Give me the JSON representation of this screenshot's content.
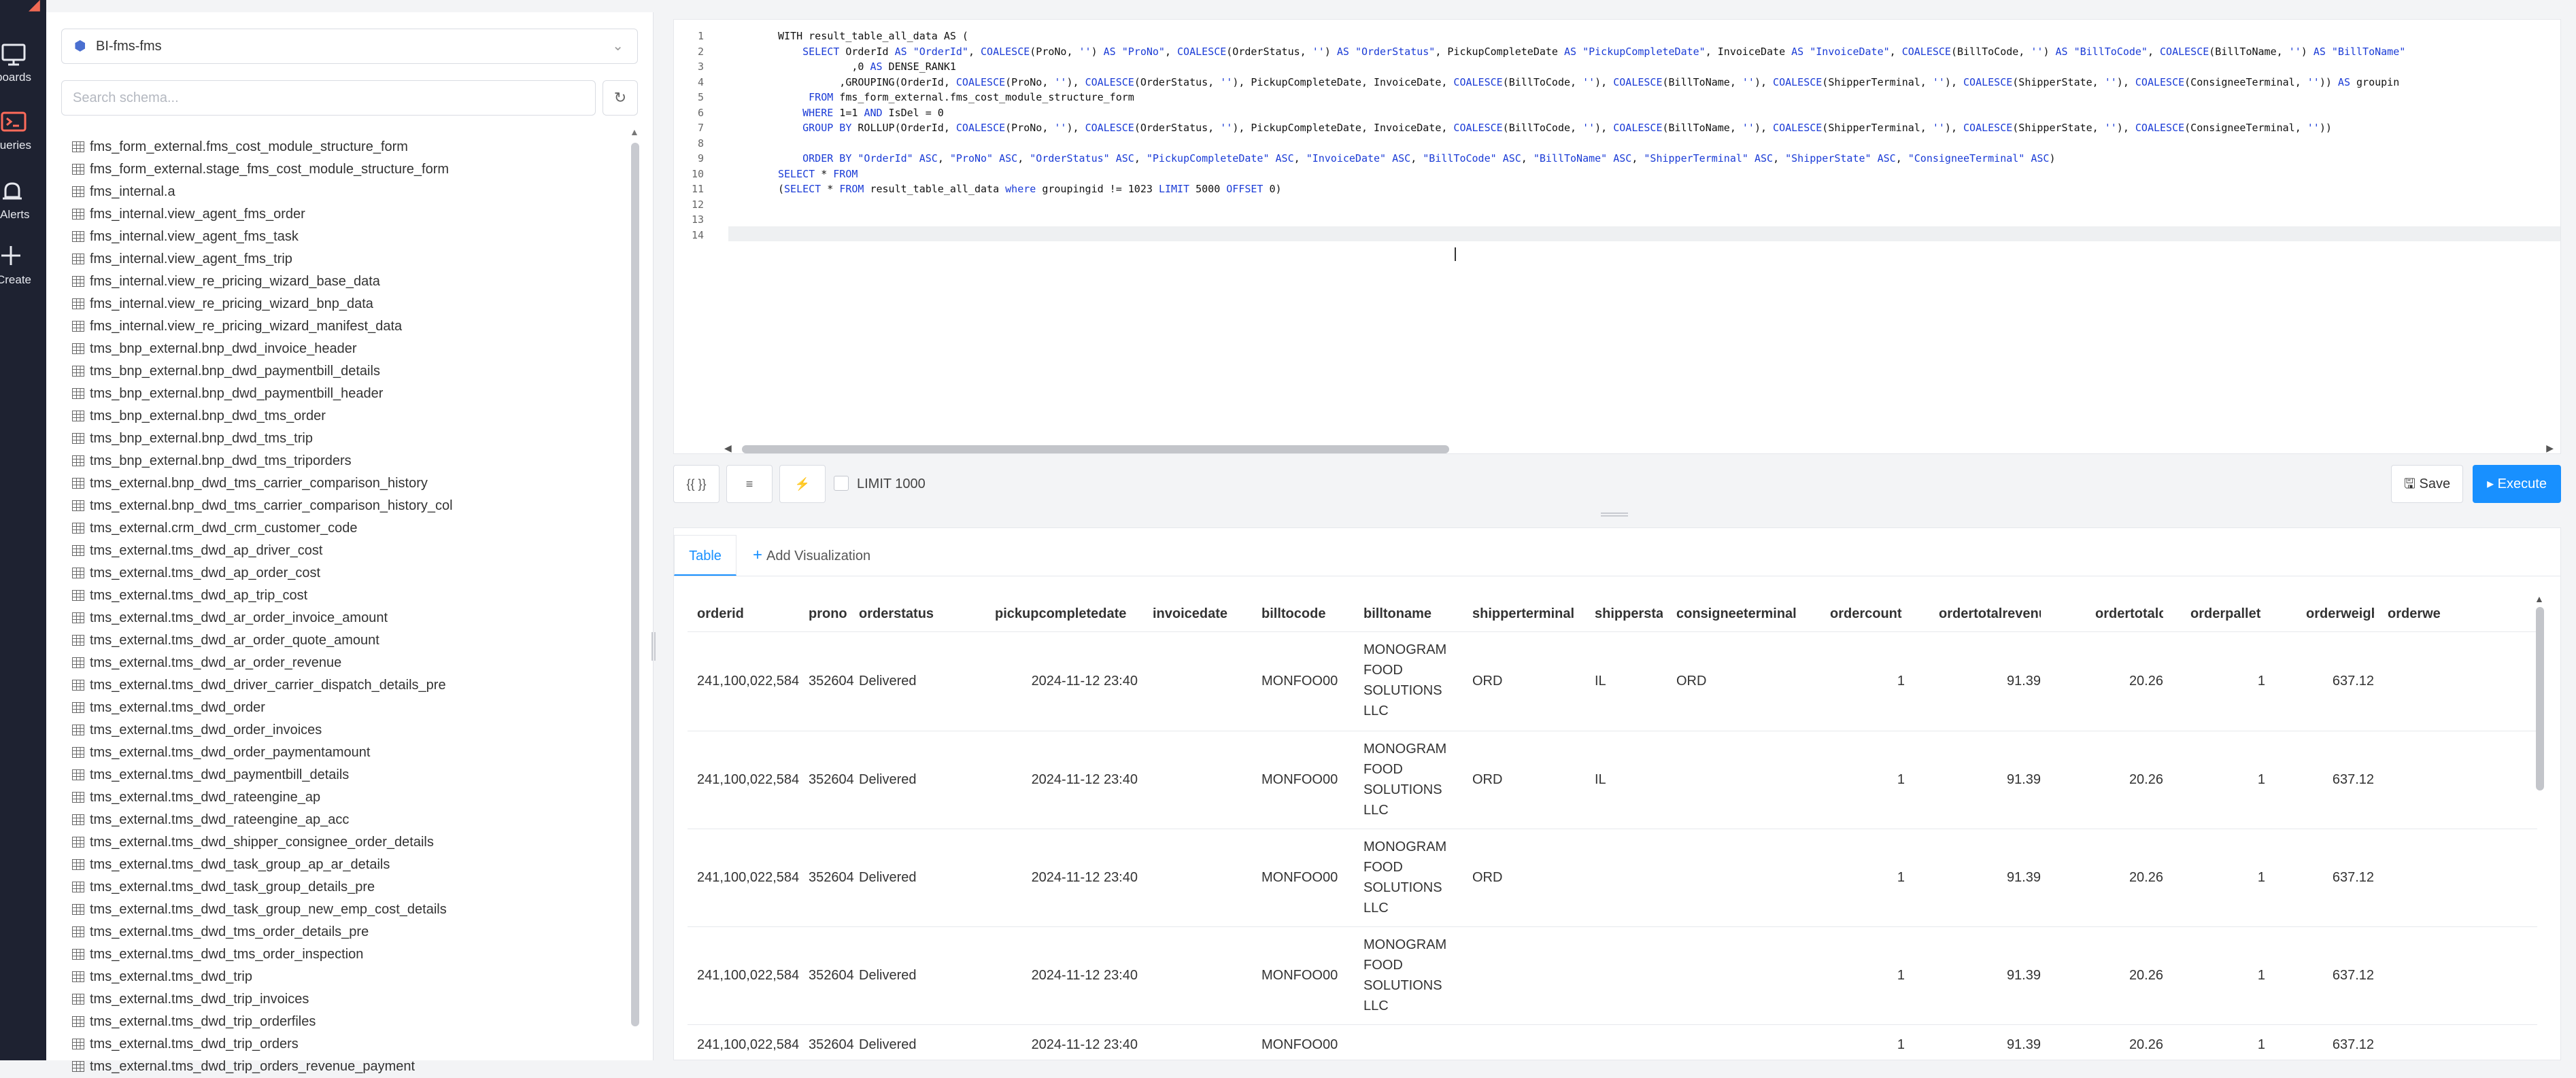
{
  "nav": {
    "items": [
      {
        "label": "Dashboards",
        "icon": "monitor-icon"
      },
      {
        "label": "Queries",
        "icon": "terminal-icon"
      },
      {
        "label": "Alerts",
        "icon": "bell-icon"
      },
      {
        "label": "Create",
        "icon": "plus-icon"
      }
    ]
  },
  "schema": {
    "database": "BI-fms-fms",
    "search_placeholder": "Search schema...",
    "tables": [
      "fms_form_external.fms_cost_module_structure_form",
      "fms_form_external.stage_fms_cost_module_structure_form",
      "fms_internal.a",
      "fms_internal.view_agent_fms_order",
      "fms_internal.view_agent_fms_task",
      "fms_internal.view_agent_fms_trip",
      "fms_internal.view_re_pricing_wizard_base_data",
      "fms_internal.view_re_pricing_wizard_bnp_data",
      "fms_internal.view_re_pricing_wizard_manifest_data",
      "tms_bnp_external.bnp_dwd_invoice_header",
      "tms_bnp_external.bnp_dwd_paymentbill_details",
      "tms_bnp_external.bnp_dwd_paymentbill_header",
      "tms_bnp_external.bnp_dwd_tms_order",
      "tms_bnp_external.bnp_dwd_tms_trip",
      "tms_bnp_external.bnp_dwd_tms_triporders",
      "tms_external.bnp_dwd_tms_carrier_comparison_history",
      "tms_external.bnp_dwd_tms_carrier_comparison_history_col",
      "tms_external.crm_dwd_crm_customer_code",
      "tms_external.tms_dwd_ap_driver_cost",
      "tms_external.tms_dwd_ap_order_cost",
      "tms_external.tms_dwd_ap_trip_cost",
      "tms_external.tms_dwd_ar_order_invoice_amount",
      "tms_external.tms_dwd_ar_order_quote_amount",
      "tms_external.tms_dwd_ar_order_revenue",
      "tms_external.tms_dwd_driver_carrier_dispatch_details_pre",
      "tms_external.tms_dwd_order",
      "tms_external.tms_dwd_order_invoices",
      "tms_external.tms_dwd_order_paymentamount",
      "tms_external.tms_dwd_paymentbill_details",
      "tms_external.tms_dwd_rateengine_ap",
      "tms_external.tms_dwd_rateengine_ap_acc",
      "tms_external.tms_dwd_shipper_consignee_order_details",
      "tms_external.tms_dwd_task_group_ap_ar_details",
      "tms_external.tms_dwd_task_group_details_pre",
      "tms_external.tms_dwd_task_group_new_emp_cost_details",
      "tms_external.tms_dwd_tms_order_details_pre",
      "tms_external.tms_dwd_tms_order_inspection",
      "tms_external.tms_dwd_trip",
      "tms_external.tms_dwd_trip_invoices",
      "tms_external.tms_dwd_trip_orderfiles",
      "tms_external.tms_dwd_trip_orders",
      "tms_external.tms_dwd_trip_orders_revenue_payment"
    ]
  },
  "editor": {
    "line_numbers": [
      "1",
      "2",
      "3",
      "4",
      "5",
      "6",
      "7",
      "8",
      "9",
      "10",
      "11",
      "12",
      "13",
      "14"
    ]
  },
  "toolbar": {
    "format_label": "{{ }}",
    "indent_label": "≡",
    "autocomplete_label": "⚡",
    "limit_label": "LIMIT 1000",
    "save_label": "Save",
    "execute_label": "Execute"
  },
  "results": {
    "tab_table": "Table",
    "tab_add_viz": "Add Visualization",
    "columns": [
      "orderid",
      "prono",
      "orderstatus",
      "pickupcompletedate",
      "invoicedate",
      "billtocode",
      "billtoname",
      "shipperterminal",
      "shipperstate",
      "consigneeterminal",
      "ordercount",
      "ordertotalrevenue",
      "ordertotalcost",
      "orderpallet",
      "orderweight",
      "orderwe"
    ],
    "rows": [
      {
        "orderid": "241,100,022,584",
        "prono": "352604",
        "orderstatus": "Delivered",
        "pickupcompletedate": "2024-11-12 23:40",
        "invoicedate": "",
        "billtocode": "MONFOO00",
        "billtoname": [
          "MONOGRAM",
          "FOOD",
          "SOLUTIONS",
          "LLC"
        ],
        "shipperterminal": "ORD",
        "shipperstate": "IL",
        "consigneeterminal": "ORD",
        "ordercount": "1",
        "ordertotalrevenue": "91.39",
        "ordertotalcost": "20.26",
        "orderpallet": "1",
        "orderweight": "637.12"
      },
      {
        "orderid": "241,100,022,584",
        "prono": "352604",
        "orderstatus": "Delivered",
        "pickupcompletedate": "2024-11-12 23:40",
        "invoicedate": "",
        "billtocode": "MONFOO00",
        "billtoname": [
          "MONOGRAM",
          "FOOD",
          "SOLUTIONS",
          "LLC"
        ],
        "shipperterminal": "ORD",
        "shipperstate": "IL",
        "consigneeterminal": "",
        "ordercount": "1",
        "ordertotalrevenue": "91.39",
        "ordertotalcost": "20.26",
        "orderpallet": "1",
        "orderweight": "637.12"
      },
      {
        "orderid": "241,100,022,584",
        "prono": "352604",
        "orderstatus": "Delivered",
        "pickupcompletedate": "2024-11-12 23:40",
        "invoicedate": "",
        "billtocode": "MONFOO00",
        "billtoname": [
          "MONOGRAM",
          "FOOD",
          "SOLUTIONS",
          "LLC"
        ],
        "shipperterminal": "ORD",
        "shipperstate": "",
        "consigneeterminal": "",
        "ordercount": "1",
        "ordertotalrevenue": "91.39",
        "ordertotalcost": "20.26",
        "orderpallet": "1",
        "orderweight": "637.12"
      },
      {
        "orderid": "241,100,022,584",
        "prono": "352604",
        "orderstatus": "Delivered",
        "pickupcompletedate": "2024-11-12 23:40",
        "invoicedate": "",
        "billtocode": "MONFOO00",
        "billtoname": [
          "MONOGRAM",
          "FOOD",
          "SOLUTIONS",
          "LLC"
        ],
        "shipperterminal": "",
        "shipperstate": "",
        "consigneeterminal": "",
        "ordercount": "1",
        "ordertotalrevenue": "91.39",
        "ordertotalcost": "20.26",
        "orderpallet": "1",
        "orderweight": "637.12"
      },
      {
        "orderid": "241,100,022,584",
        "prono": "352604",
        "orderstatus": "Delivered",
        "pickupcompletedate": "2024-11-12 23:40",
        "invoicedate": "",
        "billtocode": "MONFOO00",
        "billtoname": [],
        "shipperterminal": "",
        "shipperstate": "",
        "consigneeterminal": "",
        "ordercount": "1",
        "ordertotalrevenue": "91.39",
        "ordertotalcost": "20.26",
        "orderpallet": "1",
        "orderweight": "637.12"
      }
    ]
  },
  "sql": [
    [
      {
        "t": "WITH result_table_all_data AS ("
      }
    ],
    [
      {
        "t": "    "
      },
      {
        "t": "SELECT",
        "k": 1
      },
      {
        "t": " OrderId "
      },
      {
        "t": "AS",
        "k": 1
      },
      {
        "t": " "
      },
      {
        "t": "\"OrderId\"",
        "s": 1
      },
      {
        "t": ", "
      },
      {
        "t": "COALESCE",
        "k": 1
      },
      {
        "t": "(ProNo, "
      },
      {
        "t": "''",
        "s": 1
      },
      {
        "t": ") "
      },
      {
        "t": "AS",
        "k": 1
      },
      {
        "t": " "
      },
      {
        "t": "\"ProNo\"",
        "s": 1
      },
      {
        "t": ", "
      },
      {
        "t": "COALESCE",
        "k": 1
      },
      {
        "t": "(OrderStatus, "
      },
      {
        "t": "''",
        "s": 1
      },
      {
        "t": ") "
      },
      {
        "t": "AS",
        "k": 1
      },
      {
        "t": " "
      },
      {
        "t": "\"OrderStatus\"",
        "s": 1
      },
      {
        "t": ", PickupCompleteDate "
      },
      {
        "t": "AS",
        "k": 1
      },
      {
        "t": " "
      },
      {
        "t": "\"PickupCompleteDate\"",
        "s": 1
      },
      {
        "t": ", InvoiceDate "
      },
      {
        "t": "AS",
        "k": 1
      },
      {
        "t": " "
      },
      {
        "t": "\"InvoiceDate\"",
        "s": 1
      },
      {
        "t": ", "
      },
      {
        "t": "COALESCE",
        "k": 1
      },
      {
        "t": "(BillToCode, "
      },
      {
        "t": "''",
        "s": 1
      },
      {
        "t": ") "
      },
      {
        "t": "AS",
        "k": 1
      },
      {
        "t": " "
      },
      {
        "t": "\"BillToCode\"",
        "s": 1
      },
      {
        "t": ", "
      },
      {
        "t": "COALESCE",
        "k": 1
      },
      {
        "t": "(BillToName, "
      },
      {
        "t": "''",
        "s": 1
      },
      {
        "t": ") "
      },
      {
        "t": "AS",
        "k": 1
      },
      {
        "t": " "
      },
      {
        "t": "\"BillToName\"",
        "s": 1
      }
    ],
    [
      {
        "t": "            ,0 "
      },
      {
        "t": "AS",
        "k": 1
      },
      {
        "t": " DENSE_RANK1"
      }
    ],
    [
      {
        "t": "          ,GROUPING(OrderId, "
      },
      {
        "t": "COALESCE",
        "k": 1
      },
      {
        "t": "(ProNo, "
      },
      {
        "t": "''",
        "s": 1
      },
      {
        "t": "), "
      },
      {
        "t": "COALESCE",
        "k": 1
      },
      {
        "t": "(OrderStatus, "
      },
      {
        "t": "''",
        "s": 1
      },
      {
        "t": "), PickupCompleteDate, InvoiceDate, "
      },
      {
        "t": "COALESCE",
        "k": 1
      },
      {
        "t": "(BillToCode, "
      },
      {
        "t": "''",
        "s": 1
      },
      {
        "t": "), "
      },
      {
        "t": "COALESCE",
        "k": 1
      },
      {
        "t": "(BillToName, "
      },
      {
        "t": "''",
        "s": 1
      },
      {
        "t": "), "
      },
      {
        "t": "COALESCE",
        "k": 1
      },
      {
        "t": "(ShipperTerminal, "
      },
      {
        "t": "''",
        "s": 1
      },
      {
        "t": "), "
      },
      {
        "t": "COALESCE",
        "k": 1
      },
      {
        "t": "(ShipperState, "
      },
      {
        "t": "''",
        "s": 1
      },
      {
        "t": "), "
      },
      {
        "t": "COALESCE",
        "k": 1
      },
      {
        "t": "(ConsigneeTerminal, "
      },
      {
        "t": "''",
        "s": 1
      },
      {
        "t": ")) "
      },
      {
        "t": "AS",
        "k": 1
      },
      {
        "t": " groupin"
      }
    ],
    [
      {
        "t": "     "
      },
      {
        "t": "FROM",
        "k": 1
      },
      {
        "t": " fms_form_external.fms_cost_module_structure_form"
      }
    ],
    [
      {
        "t": "    "
      },
      {
        "t": "WHERE",
        "k": 1
      },
      {
        "t": " 1=1 "
      },
      {
        "t": "AND",
        "k": 1
      },
      {
        "t": " IsDel = 0"
      }
    ],
    [
      {
        "t": "    "
      },
      {
        "t": "GROUP BY",
        "k": 1
      },
      {
        "t": " ROLLUP(OrderId, "
      },
      {
        "t": "COALESCE",
        "k": 1
      },
      {
        "t": "(ProNo, "
      },
      {
        "t": "''",
        "s": 1
      },
      {
        "t": "), "
      },
      {
        "t": "COALESCE",
        "k": 1
      },
      {
        "t": "(OrderStatus, "
      },
      {
        "t": "''",
        "s": 1
      },
      {
        "t": "), PickupCompleteDate, InvoiceDate, "
      },
      {
        "t": "COALESCE",
        "k": 1
      },
      {
        "t": "(BillToCode, "
      },
      {
        "t": "''",
        "s": 1
      },
      {
        "t": "), "
      },
      {
        "t": "COALESCE",
        "k": 1
      },
      {
        "t": "(BillToName, "
      },
      {
        "t": "''",
        "s": 1
      },
      {
        "t": "), "
      },
      {
        "t": "COALESCE",
        "k": 1
      },
      {
        "t": "(ShipperTerminal, "
      },
      {
        "t": "''",
        "s": 1
      },
      {
        "t": "), "
      },
      {
        "t": "COALESCE",
        "k": 1
      },
      {
        "t": "(ShipperState, "
      },
      {
        "t": "''",
        "s": 1
      },
      {
        "t": "), "
      },
      {
        "t": "COALESCE",
        "k": 1
      },
      {
        "t": "(ConsigneeTerminal, "
      },
      {
        "t": "''",
        "s": 1
      },
      {
        "t": "))"
      }
    ],
    [
      {
        "t": ""
      }
    ],
    [
      {
        "t": "    "
      },
      {
        "t": "ORDER BY",
        "k": 1
      },
      {
        "t": " "
      },
      {
        "t": "\"OrderId\"",
        "s": 1
      },
      {
        "t": " "
      },
      {
        "t": "ASC",
        "k": 1
      },
      {
        "t": ", "
      },
      {
        "t": "\"ProNo\"",
        "s": 1
      },
      {
        "t": " "
      },
      {
        "t": "ASC",
        "k": 1
      },
      {
        "t": ", "
      },
      {
        "t": "\"OrderStatus\"",
        "s": 1
      },
      {
        "t": " "
      },
      {
        "t": "ASC",
        "k": 1
      },
      {
        "t": ", "
      },
      {
        "t": "\"PickupCompleteDate\"",
        "s": 1
      },
      {
        "t": " "
      },
      {
        "t": "ASC",
        "k": 1
      },
      {
        "t": ", "
      },
      {
        "t": "\"InvoiceDate\"",
        "s": 1
      },
      {
        "t": " "
      },
      {
        "t": "ASC",
        "k": 1
      },
      {
        "t": ", "
      },
      {
        "t": "\"BillToCode\"",
        "s": 1
      },
      {
        "t": " "
      },
      {
        "t": "ASC",
        "k": 1
      },
      {
        "t": ", "
      },
      {
        "t": "\"BillToName\"",
        "s": 1
      },
      {
        "t": " "
      },
      {
        "t": "ASC",
        "k": 1
      },
      {
        "t": ", "
      },
      {
        "t": "\"ShipperTerminal\"",
        "s": 1
      },
      {
        "t": " "
      },
      {
        "t": "ASC",
        "k": 1
      },
      {
        "t": ", "
      },
      {
        "t": "\"ShipperState\"",
        "s": 1
      },
      {
        "t": " "
      },
      {
        "t": "ASC",
        "k": 1
      },
      {
        "t": ", "
      },
      {
        "t": "\"ConsigneeTerminal\"",
        "s": 1
      },
      {
        "t": " "
      },
      {
        "t": "ASC",
        "k": 1
      },
      {
        "t": ")"
      }
    ],
    [
      {
        "t": "SELECT",
        "k": 1
      },
      {
        "t": " * "
      },
      {
        "t": "FROM",
        "k": 1
      }
    ],
    [
      {
        "t": "("
      },
      {
        "t": "SELECT",
        "k": 1
      },
      {
        "t": " * "
      },
      {
        "t": "FROM",
        "k": 1
      },
      {
        "t": " result_table_all_data "
      },
      {
        "t": "where",
        "k": 1
      },
      {
        "t": " groupingid != 1023 "
      },
      {
        "t": "LIMIT",
        "k": 1
      },
      {
        "t": " 5000 "
      },
      {
        "t": "OFFSET",
        "k": 1
      },
      {
        "t": " 0)"
      }
    ],
    [
      {
        "t": ""
      }
    ],
    [
      {
        "t": ""
      }
    ]
  ]
}
